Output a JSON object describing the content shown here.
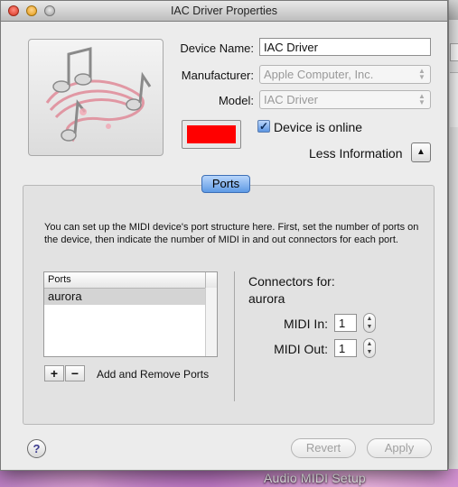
{
  "window": {
    "title": "IAC Driver Properties"
  },
  "device": {
    "name_label": "Device Name:",
    "name_value": "IAC Driver",
    "manufacturer_label": "Manufacturer:",
    "manufacturer_value": "Apple Computer, Inc.",
    "model_label": "Model:",
    "model_value": "IAC Driver",
    "color_swatch": "#ff0000",
    "online_label": "Device is online",
    "online_checked": true,
    "less_info_label": "Less Information"
  },
  "ports": {
    "tab_label": "Ports",
    "description": "You can set up the MIDI device's port structure here.  First, set the number of ports on the device, then indicate the number of MIDI in and out connectors for each port.",
    "list_header": "Ports",
    "items": [
      "aurora"
    ],
    "add_label": "+",
    "remove_label": "−",
    "add_remove_label": "Add and Remove Ports",
    "connectors_for_label": "Connectors for:",
    "connectors_port": "aurora",
    "midi_in_label": "MIDI In:",
    "midi_in_value": "1",
    "midi_out_label": "MIDI Out:",
    "midi_out_value": "1"
  },
  "footer": {
    "help_label": "?",
    "revert_label": "Revert",
    "apply_label": "Apply"
  },
  "desktop": {
    "app_label": "Audio MIDI Setup"
  }
}
